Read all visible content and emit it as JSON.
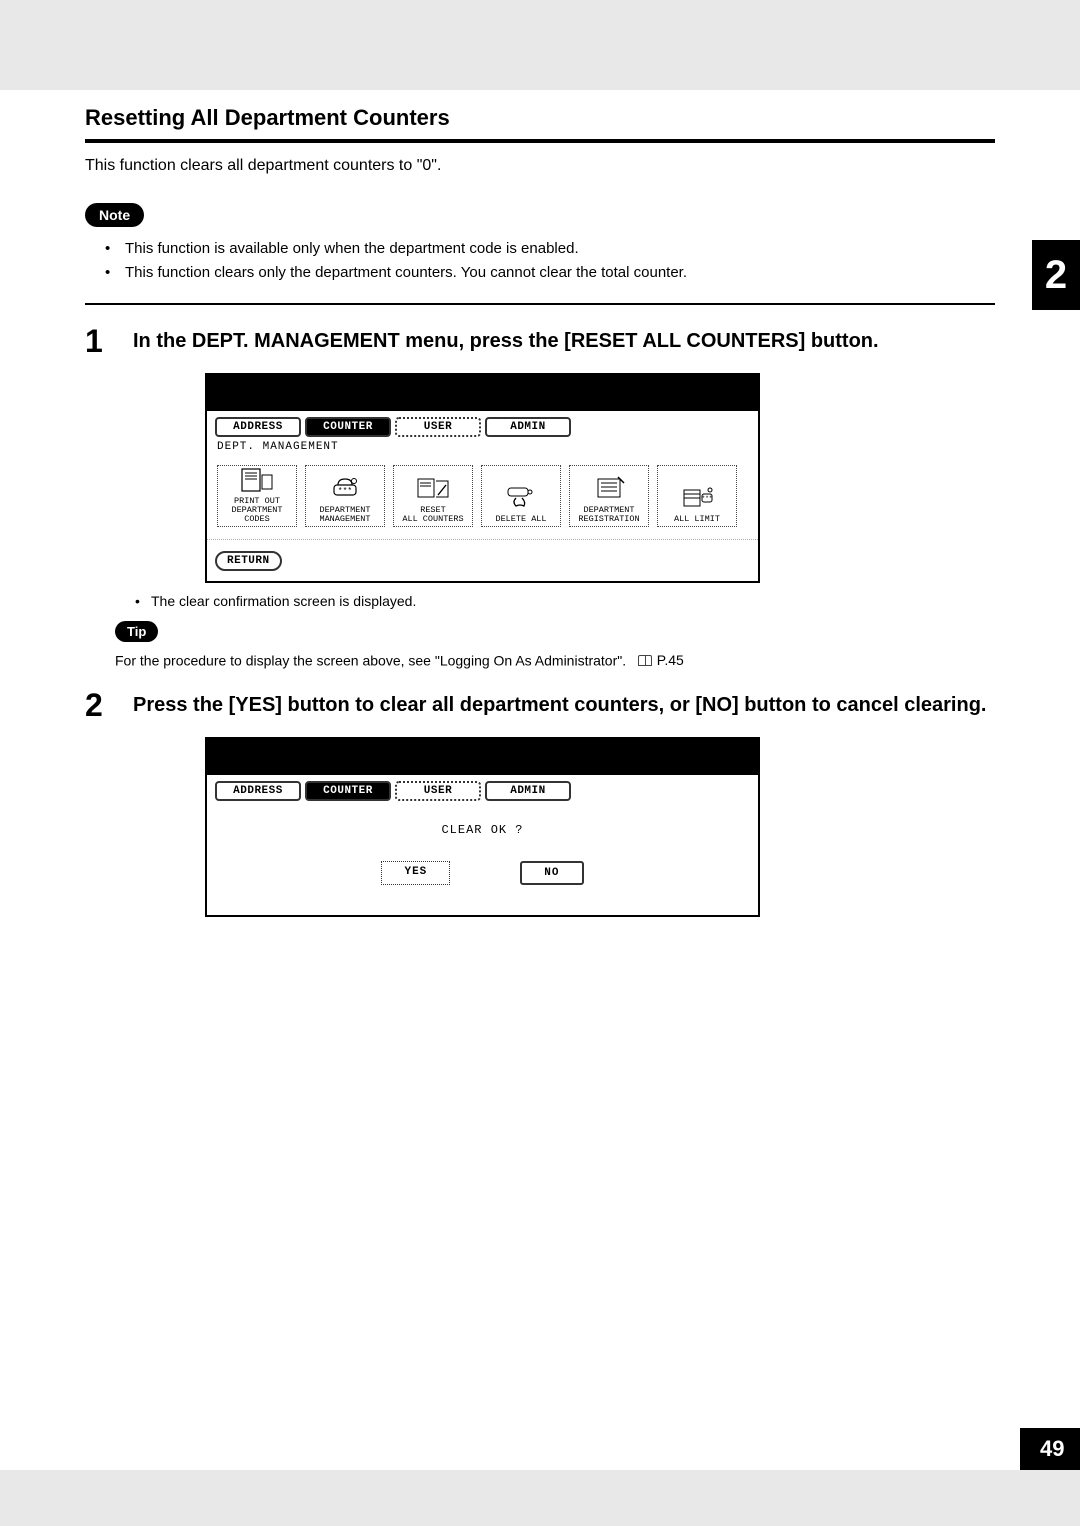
{
  "section_title": "Resetting All Department Counters",
  "intro": "This function clears all department counters to \"0\".",
  "note_label": "Note",
  "note_items": [
    "This function is available only when the department code is enabled.",
    "This function clears only the department counters.  You cannot clear the total counter."
  ],
  "steps": {
    "1": {
      "num": "1",
      "text": "In the DEPT. MANAGEMENT menu, press the [RESET ALL COUNTERS] button."
    },
    "2": {
      "num": "2",
      "text": "Press the [YES] button to clear all department counters, or [NO] button to cancel clearing."
    }
  },
  "result_bullet": "The clear confirmation screen is displayed.",
  "tip_label": "Tip",
  "tip_text": "For the procedure to display the screen above, see \"Logging On As Administrator\".",
  "page_ref": "P.45",
  "chapter_tab": "2",
  "page_number": "49",
  "screen1": {
    "tabs": {
      "address": "ADDRESS",
      "counter": "COUNTER",
      "user": "USER",
      "admin": "ADMIN"
    },
    "breadcrumb": "DEPT. MANAGEMENT",
    "buttons": {
      "print_out": "PRINT OUT\nDEPARTMENT CODES",
      "dept_mgmt": "DEPARTMENT\nMANAGEMENT",
      "reset_all": "RESET\nALL COUNTERS",
      "delete_all": "DELETE ALL",
      "dept_reg": "DEPARTMENT\nREGISTRATION",
      "all_limit": "ALL LIMIT"
    },
    "return": "RETURN"
  },
  "screen2": {
    "tabs": {
      "address": "ADDRESS",
      "counter": "COUNTER",
      "user": "USER",
      "admin": "ADMIN"
    },
    "prompt": "CLEAR OK ?",
    "yes": "YES",
    "no": "NO"
  }
}
